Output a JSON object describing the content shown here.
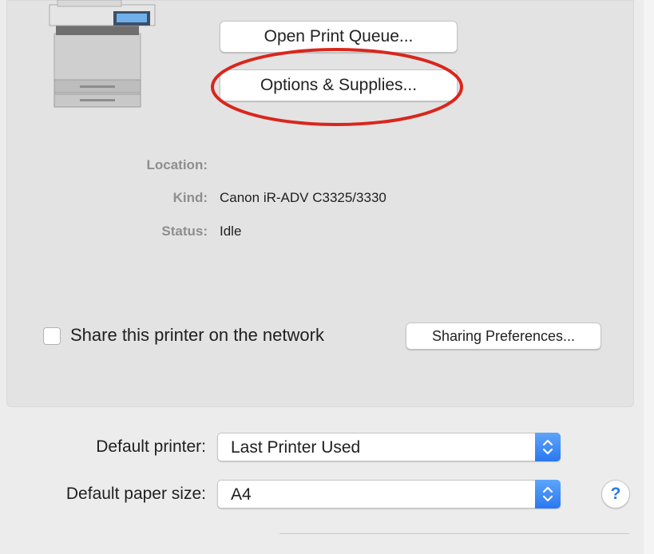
{
  "printer": {
    "buttons": {
      "open_print_queue": "Open Print Queue...",
      "options_supplies": "Options & Supplies..."
    },
    "info": {
      "location_label": "Location:",
      "location_value": "",
      "kind_label": "Kind:",
      "kind_value": "Canon iR-ADV C3325/3330",
      "status_label": "Status:",
      "status_value": "Idle"
    },
    "share": {
      "label": "Share this printer on the network",
      "checked": false,
      "sharing_preferences_button": "Sharing Preferences..."
    }
  },
  "defaults": {
    "printer_label": "Default printer:",
    "printer_value": "Last Printer Used",
    "paper_label": "Default paper size:",
    "paper_value": "A4"
  },
  "help": {
    "glyph": "?"
  },
  "colors": {
    "accent": "#2a78f0",
    "highlight_oval": "#d9261c"
  },
  "icons": {
    "printer": "printer-icon",
    "popup_stepper": "chevron-updown-icon",
    "help": "help-icon"
  }
}
